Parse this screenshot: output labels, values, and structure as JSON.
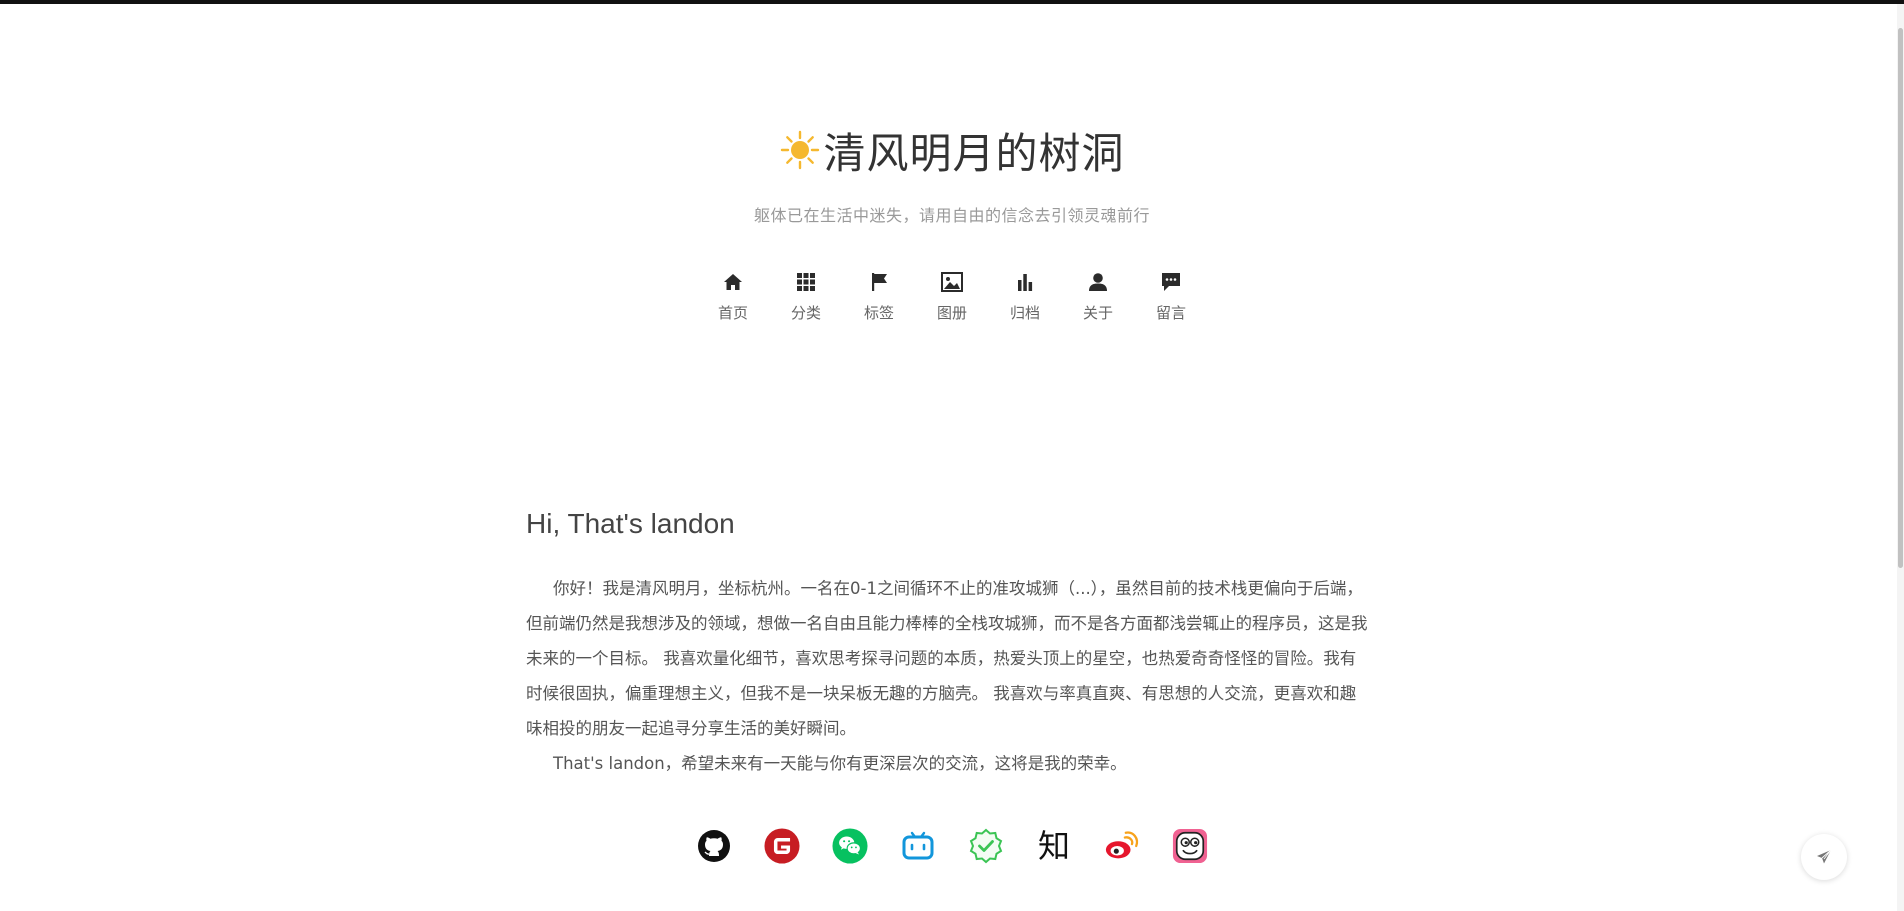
{
  "site": {
    "title": "清风明月的树洞",
    "subtitle": "躯体已在生活中迷失，请用自由的信念去引领灵魂前行"
  },
  "nav": {
    "items": [
      {
        "label": "首页",
        "icon": "home-icon"
      },
      {
        "label": "分类",
        "icon": "grid-icon"
      },
      {
        "label": "标签",
        "icon": "flag-icon"
      },
      {
        "label": "图册",
        "icon": "image-icon"
      },
      {
        "label": "归档",
        "icon": "bar-chart-icon"
      },
      {
        "label": "关于",
        "icon": "user-icon"
      },
      {
        "label": "留言",
        "icon": "message-icon"
      }
    ]
  },
  "main": {
    "heading": "Hi, That's landon",
    "paragraph1": "你好！我是清风明月，坐标杭州。一名在0-1之间循环不止的准攻城狮（...），虽然目前的技术栈更偏向于后端， 但前端仍然是我想涉及的领域，想做一名自由且能力棒棒的全栈攻城狮，而不是各方面都浅尝辄止的程序员，这是我未来的一个目标。 我喜欢量化细节，喜欢思考探寻问题的本质，热爱头顶上的星空，也热爱奇奇怪怪的冒险。我有时候很固执，偏重理想主义，但我不是一块呆板无趣的方脑壳。 我喜欢与率真直爽、有思想的人交流，更喜欢和趣味相投的朋友一起追寻分享生活的美好瞬间。",
    "paragraph2": "That's landon，希望未来有一天能与你有更深层次的交流，这将是我的荣幸。"
  },
  "social": {
    "items": [
      {
        "icon": "github-icon"
      },
      {
        "icon": "gitee-icon",
        "letter": "G"
      },
      {
        "icon": "wechat-icon"
      },
      {
        "icon": "bilibili-icon"
      },
      {
        "icon": "verified-icon"
      },
      {
        "icon": "zhihu-icon",
        "label": "知"
      },
      {
        "icon": "weibo-icon"
      },
      {
        "icon": "face-icon"
      }
    ]
  },
  "colors": {
    "sun": "#f5b82e",
    "github": "#111111",
    "gitee": "#c71d23",
    "wechat": "#07c160",
    "bilibili": "#1296db",
    "verified": "#3bc454",
    "weibo": "#e6162d",
    "face": "#f06292"
  }
}
